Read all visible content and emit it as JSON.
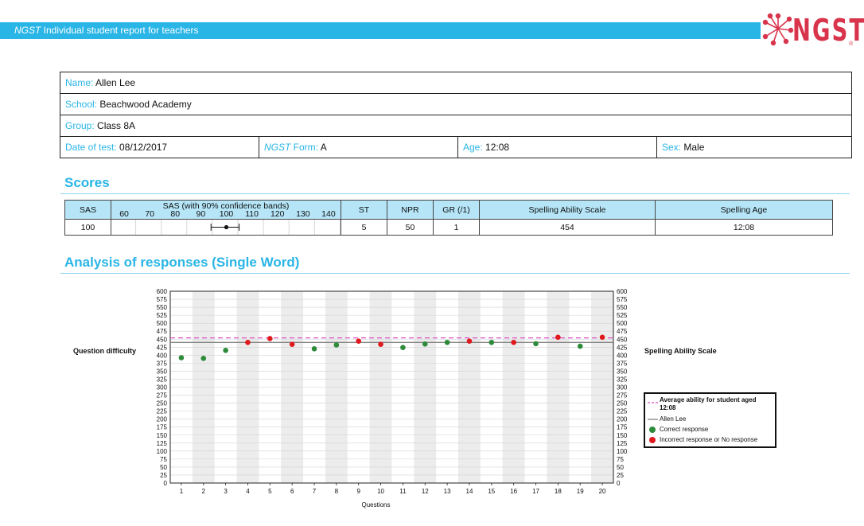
{
  "header": {
    "banner_brand": "NGST",
    "banner_text": " Individual student report for teachers",
    "logo_text": "NGST",
    "logo_mark": "®"
  },
  "student": {
    "name_label": "Name:",
    "name": "Allen Lee",
    "school_label": "School:",
    "school": "Beachwood Academy",
    "group_label": "Group:",
    "group": "Class 8A",
    "date_label": "Date of test:",
    "date": "08/12/2017",
    "form_brand": "NGST",
    "form_label": " Form:",
    "form": "A",
    "age_label": "Age:",
    "age": "12:08",
    "sex_label": "Sex:",
    "sex": "Male"
  },
  "scores_section": {
    "title": "Scores",
    "headers": {
      "sas": "SAS",
      "sas_band_title": "SAS (with 90% confidence bands)",
      "sas_ticks": [
        "60",
        "70",
        "80",
        "90",
        "100",
        "110",
        "120",
        "130",
        "140"
      ],
      "st": "ST",
      "npr": "NPR",
      "gr": "GR (/1)",
      "scale": "Spelling Ability Scale",
      "age": "Spelling Age"
    },
    "row": {
      "sas": "100",
      "st": "5",
      "npr": "50",
      "gr": "1",
      "scale": "454",
      "age": "12:08",
      "band": {
        "value": 100,
        "low": 94,
        "high": 105,
        "min": 55,
        "max": 145
      }
    }
  },
  "analysis_section": {
    "title": "Analysis of responses (Single Word)"
  },
  "chart_data": {
    "type": "scatter",
    "xlabel": "Questions",
    "ylabel_left": "Question difficulty",
    "ylabel_right": "Spelling Ability Scale",
    "x": [
      1,
      2,
      3,
      4,
      5,
      6,
      7,
      8,
      9,
      10,
      11,
      12,
      13,
      14,
      15,
      16,
      17,
      18,
      19,
      20
    ],
    "ylim": [
      0,
      600
    ],
    "ytick_step": 25,
    "series": [
      {
        "name": "Correct response",
        "color": "#2e8b3a",
        "points": [
          [
            1,
            392
          ],
          [
            2,
            390
          ],
          [
            3,
            415
          ],
          [
            7,
            420
          ],
          [
            8,
            432
          ],
          [
            11,
            424
          ],
          [
            12,
            435
          ],
          [
            13,
            440
          ],
          [
            15,
            440
          ],
          [
            17,
            436
          ],
          [
            19,
            428
          ]
        ]
      },
      {
        "name": "Incorrect response or No response",
        "color": "#e0191f",
        "points": [
          [
            4,
            440
          ],
          [
            5,
            452
          ],
          [
            6,
            434
          ],
          [
            9,
            444
          ],
          [
            10,
            434
          ],
          [
            14,
            444
          ],
          [
            16,
            440
          ],
          [
            18,
            456
          ],
          [
            20,
            456
          ]
        ]
      }
    ],
    "lines": [
      {
        "name": "Average ability for student aged",
        "name2": "12:08",
        "value": 454,
        "style": "dashed",
        "color": "#d94fc4"
      },
      {
        "name": "Allen Lee",
        "value": 440,
        "style": "solid",
        "color": "#777777"
      }
    ],
    "shaded_alternate_columns": true,
    "legend_position": "right"
  }
}
